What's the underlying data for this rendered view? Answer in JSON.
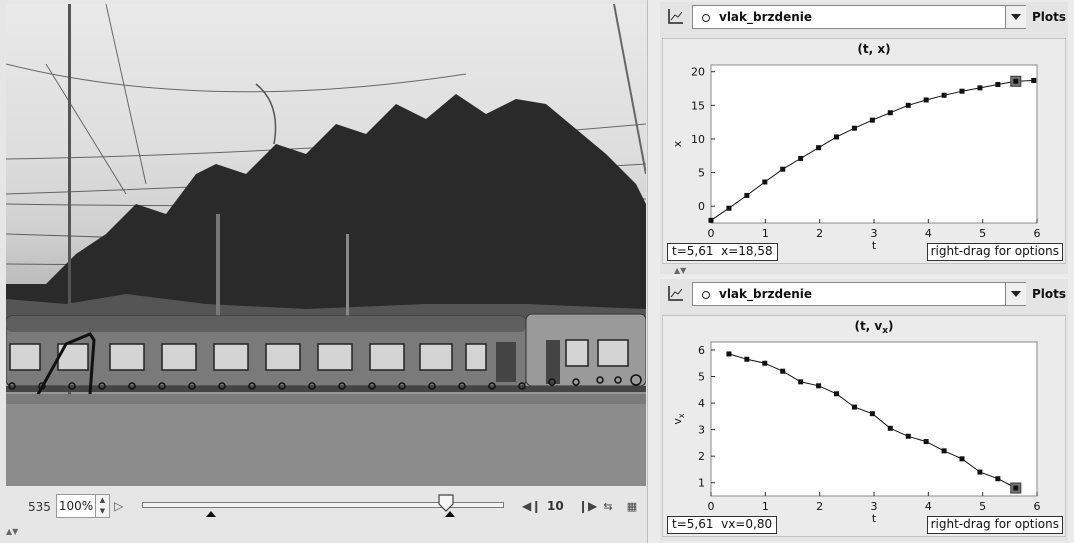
{
  "video": {
    "frame_number": "535",
    "zoom": "100%",
    "step_size": "10",
    "slider_fraction": 0.84
  },
  "plots": [
    {
      "track_name": "vlak_brzdenie",
      "plots_label": "Plots",
      "readout": "t=5,61  x=18,58",
      "hint": "right-drag for options",
      "chart_data": {
        "type": "scatter",
        "title": "(t, x)",
        "xlabel": "t",
        "ylabel": "x",
        "xlim": [
          0,
          6
        ],
        "ylim": [
          -2.5,
          21
        ],
        "xticks": [
          "0",
          "1",
          "2",
          "3",
          "4",
          "5",
          "6"
        ],
        "yticks": [
          "0",
          "5",
          "10",
          "15",
          "20"
        ],
        "grid": false,
        "series": [
          {
            "x": [
              0,
              0.33,
              0.66,
              0.99,
              1.32,
              1.65,
              1.98,
              2.31,
              2.64,
              2.97,
              3.3,
              3.63,
              3.96,
              4.29,
              4.62,
              4.95,
              5.28,
              5.61,
              5.94
            ],
            "y": [
              -2.1,
              -0.3,
              1.6,
              3.6,
              5.5,
              7.1,
              8.7,
              10.3,
              11.6,
              12.8,
              13.9,
              15.0,
              15.8,
              16.5,
              17.1,
              17.6,
              18.1,
              18.58,
              18.7
            ]
          }
        ],
        "selected_point": [
          5.61,
          18.58
        ]
      }
    },
    {
      "track_name": "vlak_brzdenie",
      "plots_label": "Plots",
      "readout": "t=5,61  vx=0,80",
      "hint": "right-drag for options",
      "chart_data": {
        "type": "scatter",
        "title_main": "(t, v",
        "title_sub": "x",
        "title_end": ")",
        "xlabel": "t",
        "ylabel_main": "v",
        "ylabel_sub": "x",
        "xlim": [
          0,
          6
        ],
        "ylim": [
          0.5,
          6.3
        ],
        "xticks": [
          "0",
          "1",
          "2",
          "3",
          "4",
          "5",
          "6"
        ],
        "yticks": [
          "1",
          "2",
          "3",
          "4",
          "5",
          "6"
        ],
        "grid": false,
        "series": [
          {
            "x": [
              0.33,
              0.66,
              0.99,
              1.32,
              1.65,
              1.98,
              2.31,
              2.64,
              2.97,
              3.3,
              3.63,
              3.96,
              4.29,
              4.62,
              4.95,
              5.28,
              5.61
            ],
            "y": [
              5.85,
              5.65,
              5.5,
              5.2,
              4.8,
              4.65,
              4.35,
              3.85,
              3.6,
              3.05,
              2.75,
              2.55,
              2.2,
              1.9,
              1.4,
              1.15,
              0.8
            ]
          }
        ],
        "selected_point": [
          5.61,
          0.8
        ]
      }
    }
  ]
}
